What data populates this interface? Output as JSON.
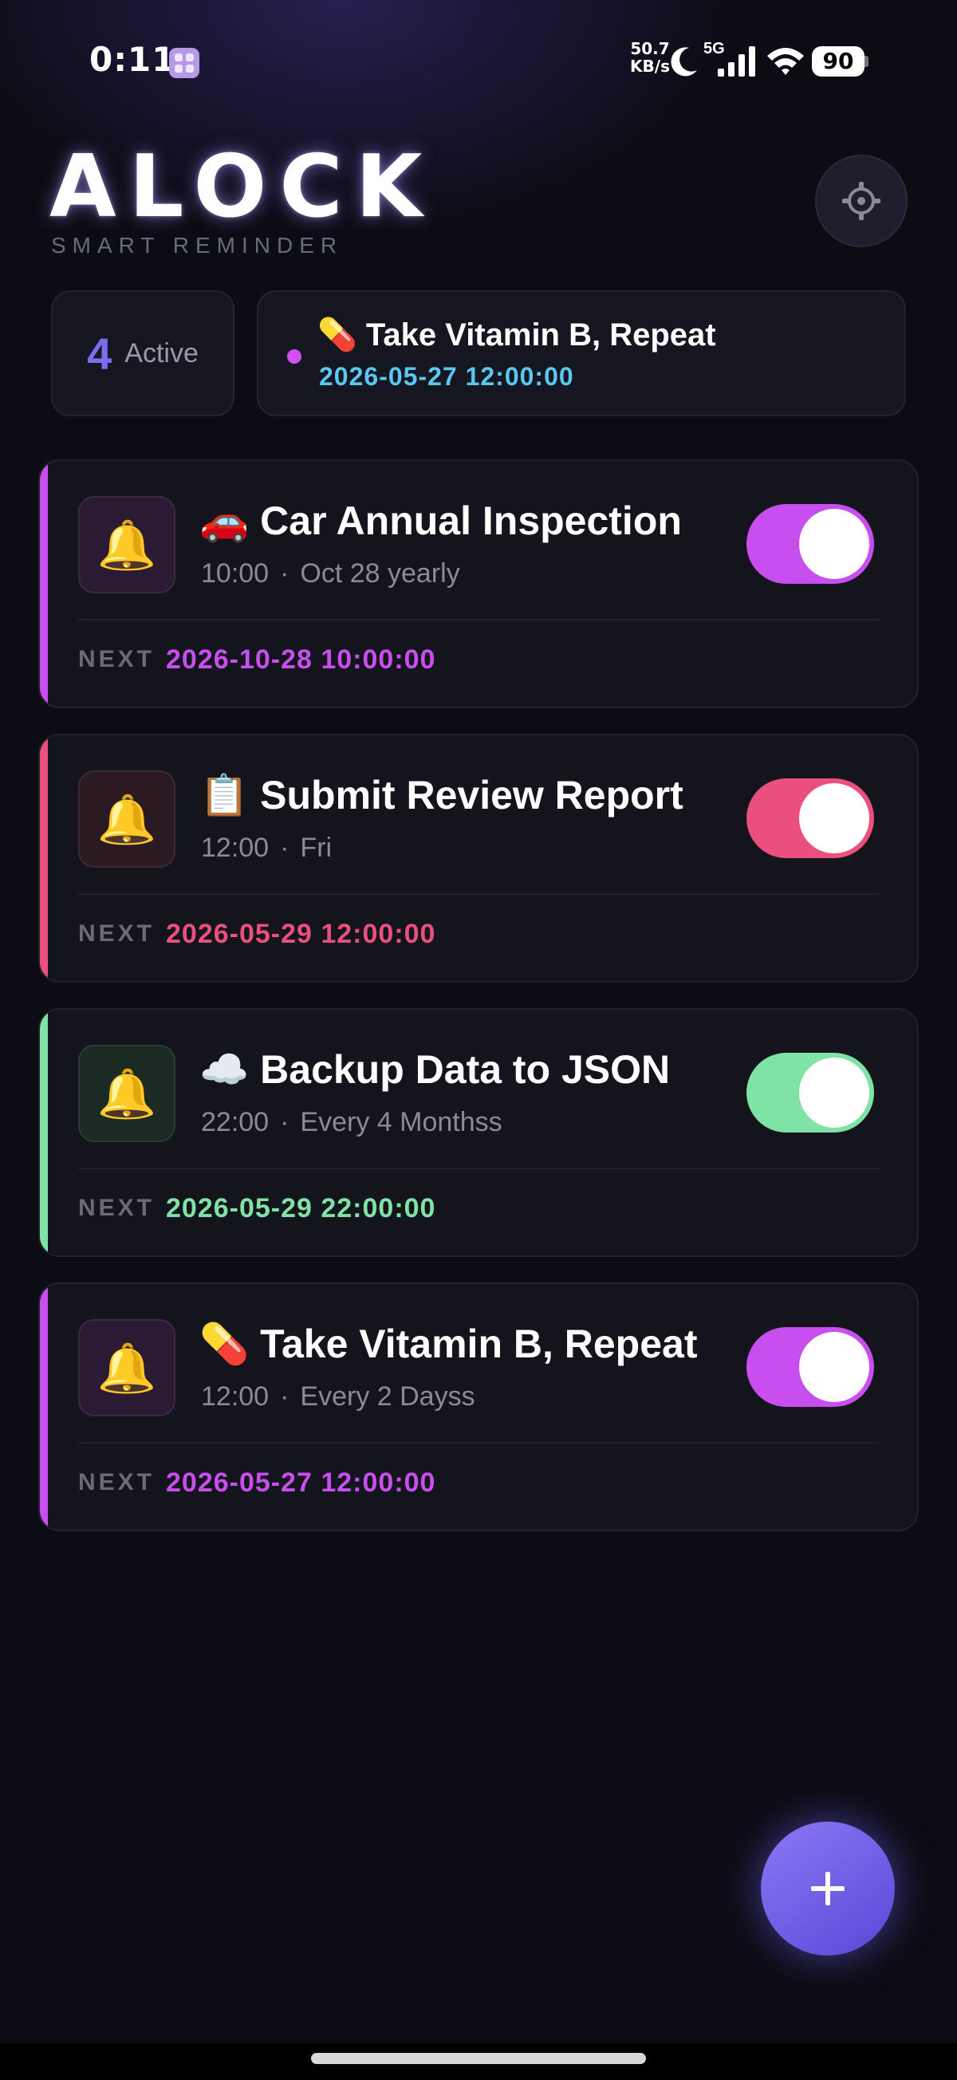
{
  "status_bar": {
    "time": "0:11",
    "net_speed_value": "50.7",
    "net_speed_unit": "KB/s",
    "network": "5G",
    "battery": "90"
  },
  "header": {
    "title": "ALOCK",
    "subtitle": "SMART REMINDER"
  },
  "summary": {
    "active_count": "4",
    "active_label": "Active",
    "next_title": "💊 Take Vitamin B, Repeat",
    "next_time": "2026-05-27 12:00:00"
  },
  "next_label": "NEXT",
  "reminders": [
    {
      "emoji_title": "🚗 Car Annual Inspection",
      "time": "10:00",
      "schedule": "Oct 28 yearly",
      "next": "2026-10-28 10:00:00",
      "enabled": true,
      "color": "#c84ef0"
    },
    {
      "emoji_title": "📋 Submit Review Report",
      "time": "12:00",
      "schedule": "Fri",
      "next": "2026-05-29 12:00:00",
      "enabled": true,
      "color": "#ea4f7e"
    },
    {
      "emoji_title": "☁️ Backup Data to JSON",
      "time": "22:00",
      "schedule": "Every 4 Monthss",
      "next": "2026-05-29 22:00:00",
      "enabled": true,
      "color": "#7fe3a6"
    },
    {
      "emoji_title": "💊 Take Vitamin B, Repeat",
      "time": "12:00",
      "schedule": "Every 2 Dayss",
      "next": "2026-05-27 12:00:00",
      "enabled": true,
      "color": "#c84ef0"
    }
  ],
  "icons": {
    "bell": "🔔",
    "settings": "gear-icon",
    "add": "plus-icon"
  },
  "colors": {
    "accent": "#7c6cf0",
    "next_time_header": "#58c8f0"
  }
}
